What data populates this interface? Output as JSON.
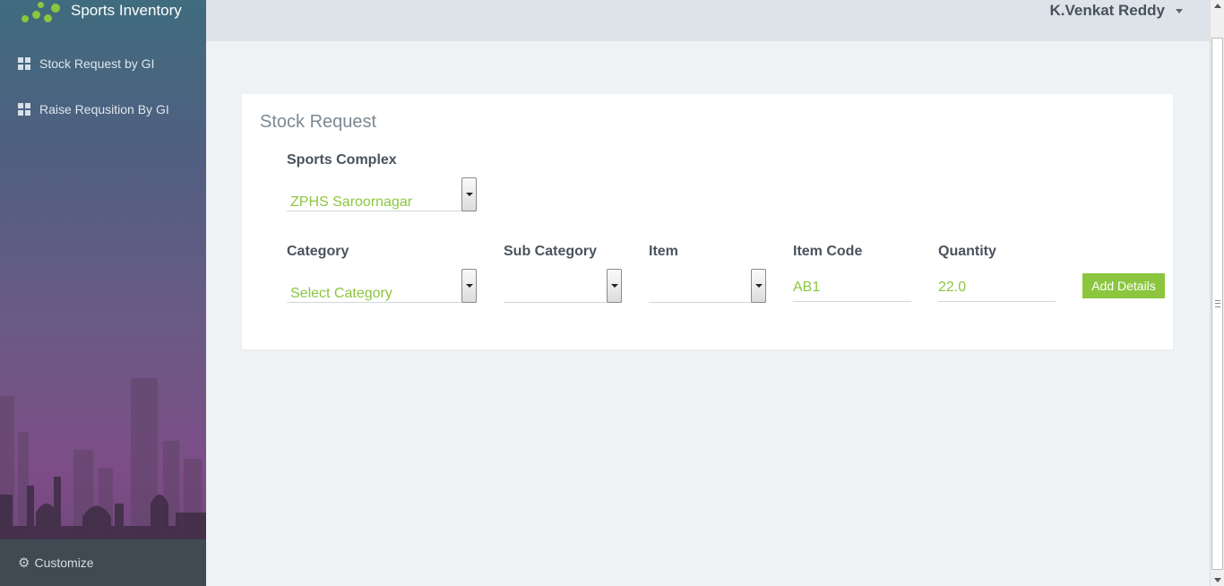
{
  "app": {
    "title": "Sports Inventory"
  },
  "sidebar": {
    "items": [
      {
        "label": "Stock Request by GI",
        "icon": "grid-icon"
      },
      {
        "label": "Raise Requsition By GI",
        "icon": "grid-icon"
      }
    ],
    "customize_label": "Customize"
  },
  "header": {
    "user_name": "K.Venkat Reddy"
  },
  "form": {
    "title": "Stock Request",
    "sports_complex": {
      "label": "Sports Complex",
      "value": "ZPHS Saroornagar"
    },
    "category": {
      "label": "Category",
      "value": "Select Category"
    },
    "sub_category": {
      "label": "Sub Category",
      "value": ""
    },
    "item": {
      "label": "Item",
      "value": ""
    },
    "item_code": {
      "label": "Item Code",
      "value": "AB1"
    },
    "quantity": {
      "label": "Quantity",
      "value": "22.0"
    },
    "add_button": "Add Details"
  },
  "colors": {
    "accent": "#8cc63f",
    "sidebar_top": "#3f6c7e",
    "sidebar_bottom": "#7d4d87"
  }
}
